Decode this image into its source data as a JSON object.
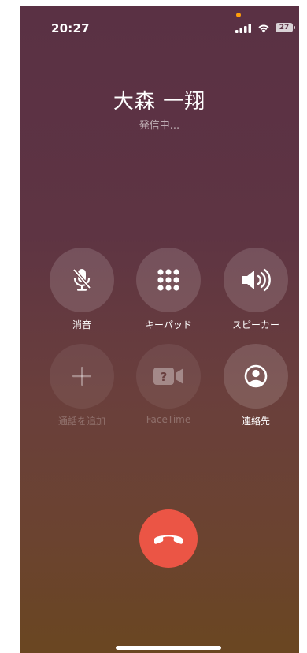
{
  "status_bar": {
    "time": "20:27",
    "battery": "27",
    "privacy_indicator_color": "#ff9f0a"
  },
  "call": {
    "caller_name": "大森 一翔",
    "status": "発信中..."
  },
  "controls": [
    {
      "id": "mute",
      "label": "消音",
      "icon": "mic-slash-icon",
      "enabled": true
    },
    {
      "id": "keypad",
      "label": "キーパッド",
      "icon": "keypad-icon",
      "enabled": true
    },
    {
      "id": "speaker",
      "label": "スピーカー",
      "icon": "speaker-icon",
      "enabled": true
    },
    {
      "id": "add-call",
      "label": "通話を追加",
      "icon": "plus-icon",
      "enabled": false
    },
    {
      "id": "facetime",
      "label": "FaceTime",
      "icon": "video-question-icon",
      "enabled": false
    },
    {
      "id": "contacts",
      "label": "連絡先",
      "icon": "person-circle-icon",
      "enabled": true
    }
  ],
  "end_call": {
    "icon": "phone-down-icon",
    "color": "#eb5545"
  }
}
